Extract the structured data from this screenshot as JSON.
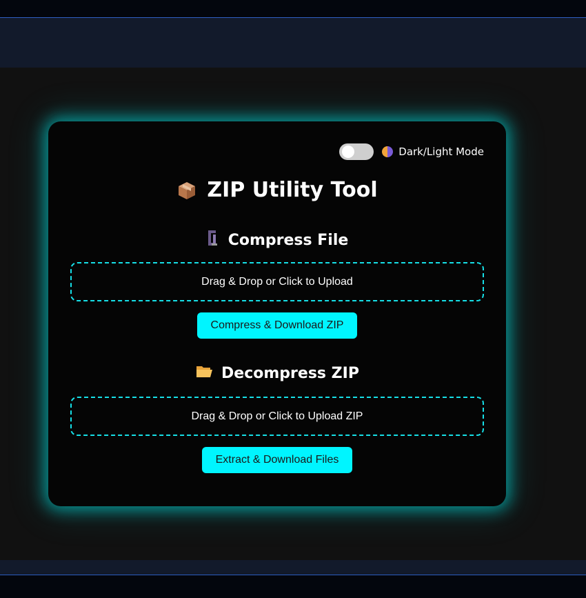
{
  "mode_toggle": {
    "label": "Dark/Light Mode",
    "state": "off"
  },
  "app": {
    "title": "ZIP Utility Tool",
    "title_icon": "package-icon"
  },
  "compress": {
    "heading": "Compress File",
    "heading_icon": "clamp-icon",
    "drop_text": "Drag & Drop or Click to Upload",
    "button_label": "Compress & Download ZIP"
  },
  "decompress": {
    "heading": "Decompress ZIP",
    "heading_icon": "open-folder-icon",
    "drop_text": "Drag & Drop or Click to Upload ZIP",
    "button_label": "Extract & Download Files"
  },
  "colors": {
    "accent": "#00f5ff",
    "glow": "#00e6e6",
    "card_bg": "#050505",
    "page_bg": "#111111"
  }
}
